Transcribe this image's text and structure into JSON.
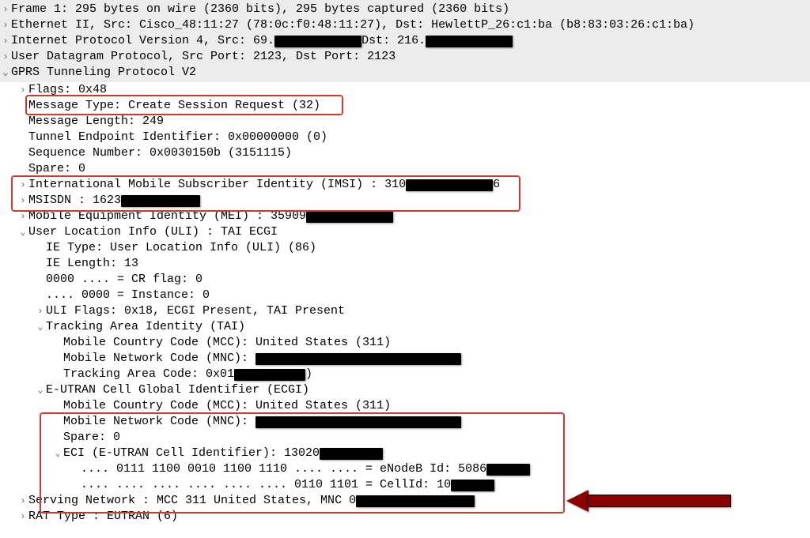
{
  "glyph": {
    "closed": "›",
    "open": "⌄"
  },
  "colors": {
    "highlight": "#cc3b30",
    "arrow": "#8b0000",
    "topbg": "#ececec"
  },
  "top": {
    "frame": "Frame 1: 295 bytes on wire (2360 bits), 295 bytes captured (2360 bits)",
    "eth": "Ethernet II, Src: Cisco_48:11:27 (78:0c:f0:48:11:27), Dst: HewlettP_26:c1:ba (b8:83:03:26:c1:ba)",
    "ip_pre": "Internet Protocol Version 4, Src: 69.",
    "ip_mid": "Dst: 216.",
    "udp": "User Datagram Protocol, Src Port: 2123, Dst Port: 2123",
    "gtp": "GPRS Tunneling Protocol V2"
  },
  "gtp": {
    "flags": "Flags: 0x48",
    "msgtype": "Message Type: Create Session Request (32)",
    "msglen": "Message Length: 249",
    "teid": "Tunnel Endpoint Identifier: 0x00000000 (0)",
    "seq": "Sequence Number: 0x0030150b (3151115)",
    "spare": "Spare: 0",
    "imsi_pre": "International Mobile Subscriber Identity (IMSI) : 310",
    "imsi_post": "6",
    "msisdn_pre": "MSISDN : 1623",
    "mei_pre": "Mobile Equipment Identity (MEI) : 35909"
  },
  "uli": {
    "hdr": "User Location Info (ULI) : TAI ECGI",
    "ietype": "IE Type: User Location Info (ULI) (86)",
    "ielen": "IE Length: 13",
    "cr": "0000 .... = CR flag: 0",
    "inst": ".... 0000 = Instance: 0",
    "flags": "ULI Flags: 0x18, ECGI Present, TAI Present"
  },
  "tai": {
    "hdr": "Tracking Area Identity (TAI)",
    "mcc": "Mobile Country Code (MCC): United States (311)",
    "mnc_pre": "Mobile Network Code (MNC): ",
    "tac_pre": "Tracking Area Code: 0x01",
    "tac_post": ")"
  },
  "ecgi": {
    "hdr": "E-UTRAN Cell Global Identifier (ECGI)",
    "mcc": "Mobile Country Code (MCC): United States (311)",
    "mnc_pre": "Mobile Network Code (MNC): ",
    "spare": "Spare: 0",
    "eci_pre": "ECI (E-UTRAN Cell Identifier): 13020",
    "enb_pre": ".... 0111 1100 0010 1100 1110 .... .... = eNodeB Id: 5086",
    "cell_pre": ".... .... .... .... .... .... 0110 1101 = CellId: 10"
  },
  "tail": {
    "serving_pre": "Serving Network : MCC 311 United States, MNC 0",
    "rat": "RAT Type : EUTRAN (6)"
  }
}
